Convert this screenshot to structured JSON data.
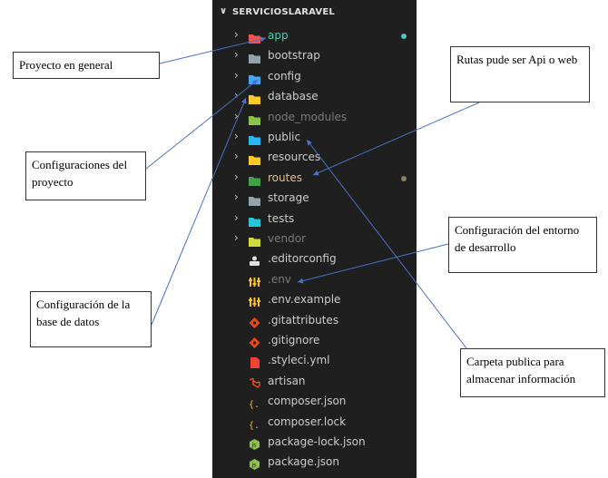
{
  "explorer": {
    "title": "SERVICIOSLARAVEL",
    "folders": [
      {
        "label": "app",
        "icon": "app-folder-icon",
        "color": "#ef5350",
        "text_color": "#4ec9b0",
        "dot": "#4ec9b0"
      },
      {
        "label": "bootstrap",
        "icon": "folder-icon",
        "color": "#90a4ae",
        "text_color": "#cccccc"
      },
      {
        "label": "config",
        "icon": "config-folder-icon",
        "color": "#42a5f5",
        "text_color": "#cccccc"
      },
      {
        "label": "database",
        "icon": "database-folder-icon",
        "color": "#ffca28",
        "text_color": "#cccccc"
      },
      {
        "label": "node_modules",
        "icon": "node-folder-icon",
        "color": "#8bc34a",
        "text_color": "#7a7a7a"
      },
      {
        "label": "public",
        "icon": "public-folder-icon",
        "color": "#29b6f6",
        "text_color": "#cccccc"
      },
      {
        "label": "resources",
        "icon": "resources-folder-icon",
        "color": "#ffca28",
        "text_color": "#cccccc"
      },
      {
        "label": "routes",
        "icon": "routes-folder-icon",
        "color": "#43a047",
        "text_color": "#e2c08d",
        "dot": "#8a7f5f"
      },
      {
        "label": "storage",
        "icon": "folder-icon",
        "color": "#90a4ae",
        "text_color": "#cccccc"
      },
      {
        "label": "tests",
        "icon": "tests-folder-icon",
        "color": "#26c6da",
        "text_color": "#cccccc"
      },
      {
        "label": "vendor",
        "icon": "vendor-folder-icon",
        "color": "#cddc39",
        "text_color": "#7a7a7a"
      }
    ],
    "files": [
      {
        "label": ".editorconfig",
        "icon": "editorconfig-icon",
        "color": "#e0e0e0",
        "text_color": "#cccccc"
      },
      {
        "label": ".env",
        "icon": "env-icon",
        "color": "#fbc02d",
        "text_color": "#7a7a7a"
      },
      {
        "label": ".env.example",
        "icon": "env-icon",
        "color": "#fbc02d",
        "text_color": "#cccccc"
      },
      {
        "label": ".gitattributes",
        "icon": "git-icon",
        "color": "#e64a19",
        "text_color": "#cccccc"
      },
      {
        "label": ".gitignore",
        "icon": "git-icon",
        "color": "#e64a19",
        "text_color": "#cccccc"
      },
      {
        "label": ".styleci.yml",
        "icon": "yaml-icon",
        "color": "#f44336",
        "text_color": "#cccccc"
      },
      {
        "label": "artisan",
        "icon": "laravel-icon",
        "color": "#f4511e",
        "text_color": "#cccccc"
      },
      {
        "label": "composer.json",
        "icon": "json-icon",
        "color": "#fbc02d",
        "text_color": "#cccccc"
      },
      {
        "label": "composer.lock",
        "icon": "json-icon",
        "color": "#fbc02d",
        "text_color": "#cccccc"
      },
      {
        "label": "package-lock.json",
        "icon": "nodejs-icon",
        "color": "#8bc34a",
        "text_color": "#cccccc"
      },
      {
        "label": "package.json",
        "icon": "nodejs-icon",
        "color": "#8bc34a",
        "text_color": "#cccccc"
      }
    ]
  },
  "callouts": {
    "proyecto": "Proyecto en general",
    "configuraciones": "Configuraciones del proyecto",
    "base_datos": "Configuración de la base de datos",
    "rutas": "Rutas pude ser Api o web",
    "entorno": "Configuración del entorno de desarrollo",
    "publica": "Carpeta publica para almacenar información"
  },
  "colors": {
    "explorer_bg": "#1f1f1f",
    "arrow": "#4a72c4"
  }
}
